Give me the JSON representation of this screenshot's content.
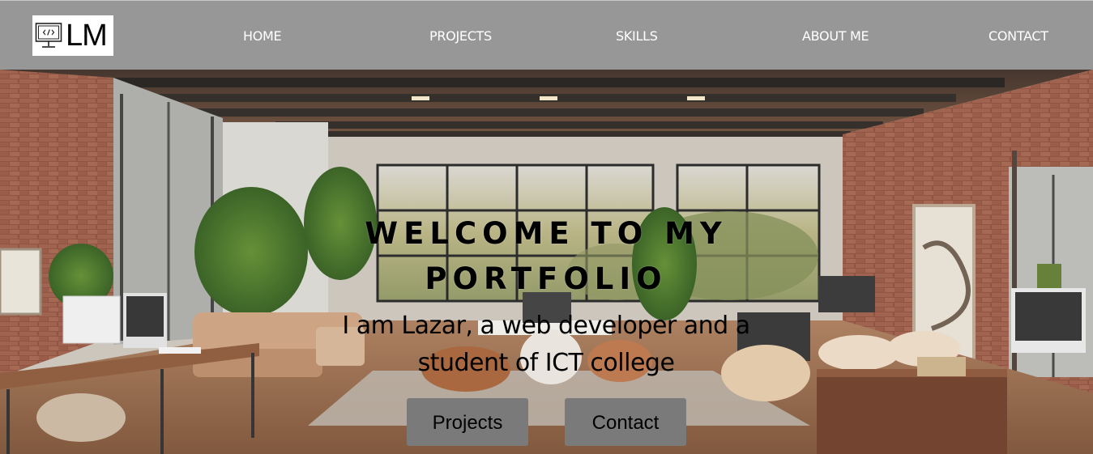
{
  "logo": {
    "text": "LM",
    "icon": "code-monitor-icon"
  },
  "nav": {
    "items": [
      {
        "label": "HOME"
      },
      {
        "label": "PROJECTS"
      },
      {
        "label": "SKILLS"
      },
      {
        "label": "ABOUT ME"
      },
      {
        "label": "CONTACT"
      }
    ]
  },
  "hero": {
    "title_line1": "WELCOME TO MY",
    "title_line2": "PORTFOLIO",
    "subtitle_line1": "I am Lazar, a web developer and a",
    "subtitle_line2": "student of ICT college",
    "buttons": [
      {
        "label": "Projects"
      },
      {
        "label": "Contact"
      }
    ]
  },
  "colors": {
    "navbar_bg": "#979797",
    "nav_text": "#ffffff",
    "button_bg": "#7a7a7a",
    "text_dark": "#000000"
  }
}
